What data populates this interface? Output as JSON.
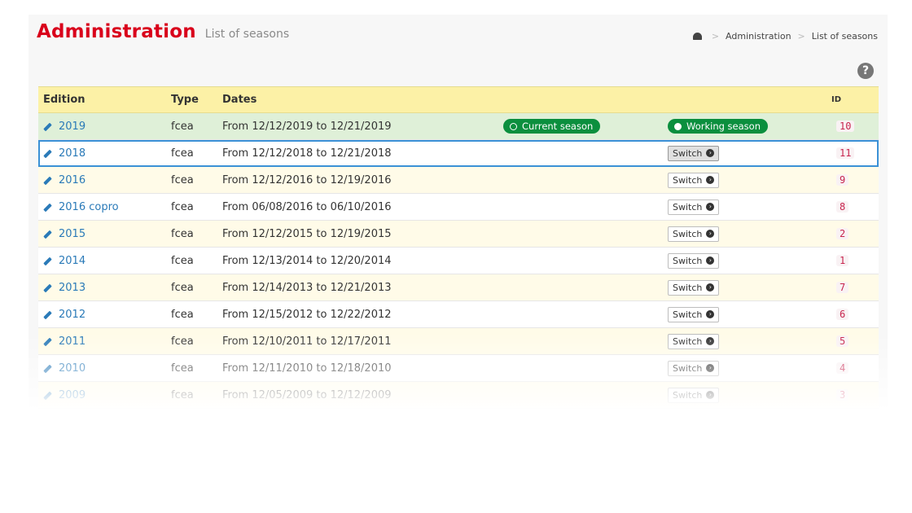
{
  "header": {
    "title": "Administration",
    "subtitle": "List of seasons"
  },
  "breadcrumb": {
    "home_icon": "dashboard-icon",
    "separator": ">",
    "items": [
      "Administration",
      "List of seasons"
    ]
  },
  "help_icon": "question-circle-icon",
  "table": {
    "columns": [
      "Edition",
      "Type",
      "Dates",
      "",
      "",
      "ID"
    ],
    "switch_label": "Switch",
    "rows": [
      {
        "edition": "2019",
        "type": "fcea",
        "dates": "From 12/12/2019 to 12/21/2019",
        "current_badge": "Current season",
        "working_badge": "Working season",
        "id": "10"
      },
      {
        "edition": "2018",
        "type": "fcea",
        "dates": "From 12/12/2018 to 12/21/2018",
        "id": "11"
      },
      {
        "edition": "2016",
        "type": "fcea",
        "dates": "From 12/12/2016 to 12/19/2016",
        "id": "9"
      },
      {
        "edition": "2016 copro",
        "type": "fcea",
        "dates": "From 06/08/2016 to 06/10/2016",
        "id": "8"
      },
      {
        "edition": "2015",
        "type": "fcea",
        "dates": "From 12/12/2015 to 12/19/2015",
        "id": "2"
      },
      {
        "edition": "2014",
        "type": "fcea",
        "dates": "From 12/13/2014 to 12/20/2014",
        "id": "1"
      },
      {
        "edition": "2013",
        "type": "fcea",
        "dates": "From 12/14/2013 to 12/21/2013",
        "id": "7"
      },
      {
        "edition": "2012",
        "type": "fcea",
        "dates": "From 12/15/2012 to 12/22/2012",
        "id": "6"
      },
      {
        "edition": "2011",
        "type": "fcea",
        "dates": "From 12/10/2011 to 12/17/2011",
        "id": "5"
      },
      {
        "edition": "2010",
        "type": "fcea",
        "dates": "From 12/11/2010 to 12/18/2010",
        "id": "4"
      },
      {
        "edition": "2009",
        "type": "fcea",
        "dates": "From 12/05/2009 to 12/12/2009",
        "id": "3"
      }
    ]
  },
  "colors": {
    "title_red": "#d9001b",
    "header_yellow": "#fcf1a6",
    "current_row_green": "#dff0d8",
    "badge_green": "#0b8f3e",
    "selected_outline": "#3b91d6",
    "link_blue": "#2a7ab8",
    "id_pink": "#c7254e"
  }
}
